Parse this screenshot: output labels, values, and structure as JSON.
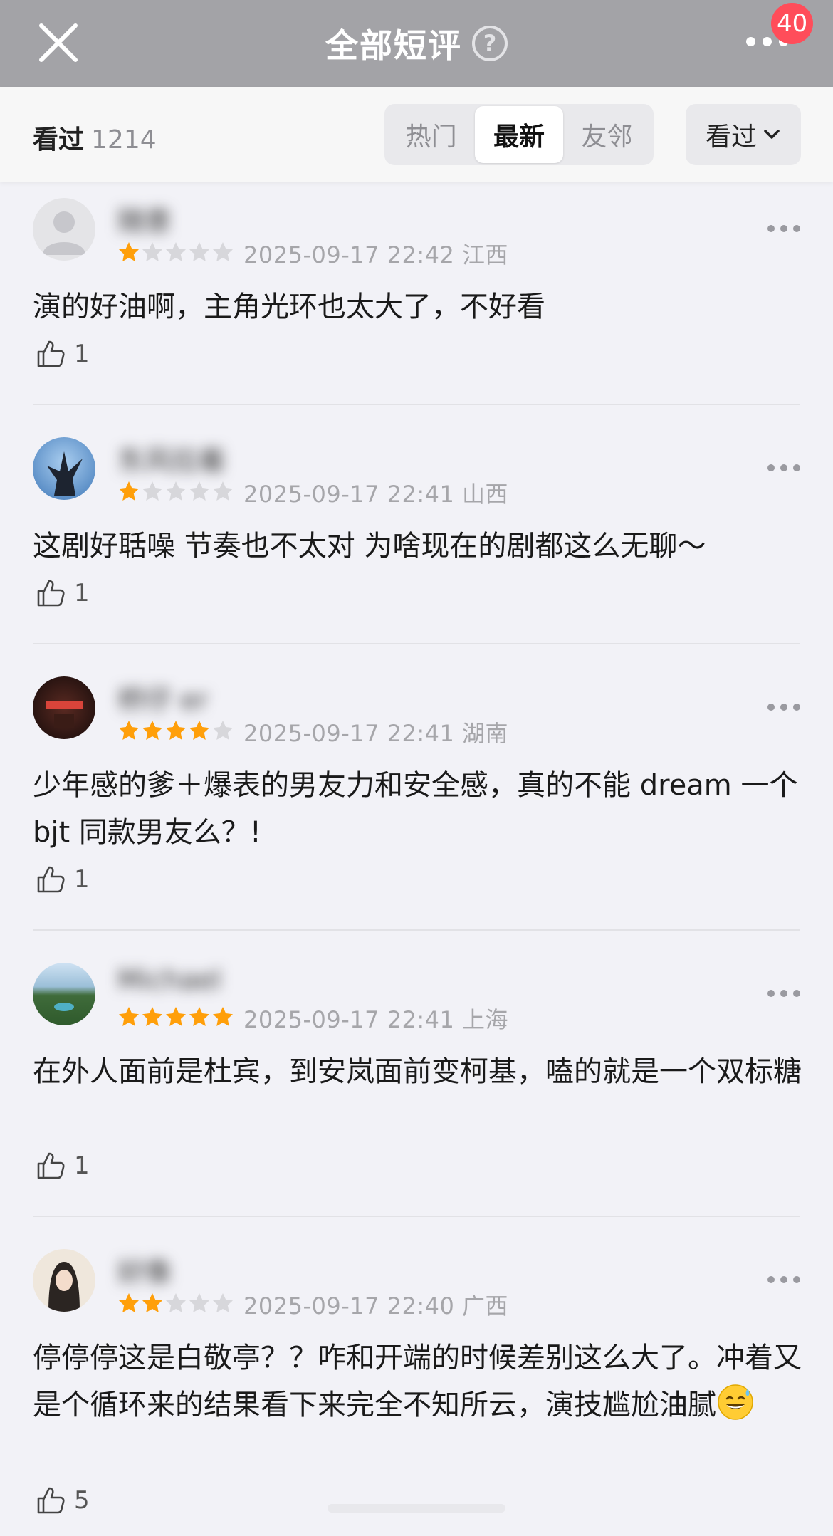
{
  "header": {
    "title": "全部短评",
    "help_symbol": "?",
    "notification_count": "40"
  },
  "filter": {
    "watched_label": "看过",
    "watched_count": "1214",
    "tabs": [
      "热门",
      "最新",
      "友邻"
    ],
    "active_tab": "最新",
    "dropdown_label": "看过"
  },
  "reviews": [
    {
      "username": "随意",
      "rating": 1,
      "date": "2025-09-17 22:42",
      "location": "江西",
      "text": "演的好油啊，主角光环也太大了，不好看",
      "likes": "1"
    },
    {
      "username": "东风拉着",
      "rating": 1,
      "date": "2025-09-17 22:41",
      "location": "山西",
      "text": "这剧好聒噪 节奏也不太对 为啥现在的剧都这么无聊～",
      "likes": "1"
    },
    {
      "username": "桥仔 er",
      "rating": 4,
      "date": "2025-09-17 22:41",
      "location": "湖南",
      "text": "少年感的爹＋爆表的男友力和安全感，真的不能 dream 一个 bjt 同款男友么？!",
      "likes": "1"
    },
    {
      "username": "Michael",
      "rating": 5,
      "date": "2025-09-17 22:41",
      "location": "上海",
      "text": "在外人面前是杜宾，到安岚面前变柯基，嗑的就是一个双标糖",
      "likes": "1"
    },
    {
      "username": "好像",
      "rating": 2,
      "date": "2025-09-17 22:40",
      "location": "广西",
      "text": "停停停这是白敬亭？？咋和开端的时候差别这么大了。冲着又是个循环来的结果看下来完全不知所云，演技尴尬油腻",
      "likes": "5"
    }
  ],
  "colors": {
    "star_on": "#ff9f0a",
    "star_off": "#d7d7db",
    "header_bg": "#a3a3a7",
    "badge": "#ff4d5a"
  },
  "icons": [
    "close-icon",
    "help-icon",
    "more-icon",
    "chevron-down-icon",
    "star-icon",
    "thumbs-up-icon",
    "sweat-smile-emoji"
  ]
}
